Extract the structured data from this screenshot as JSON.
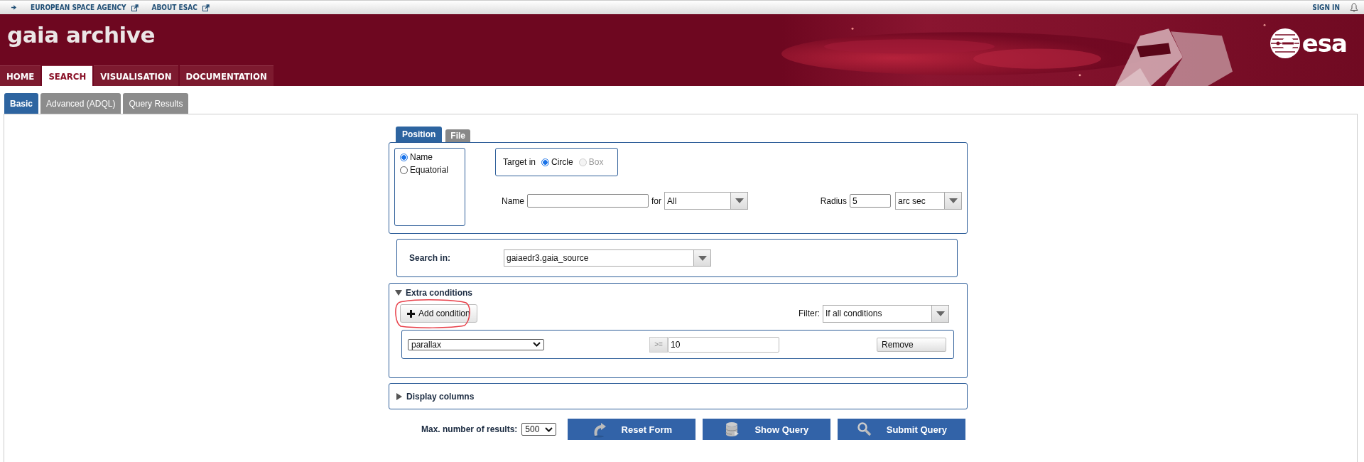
{
  "top_bar": {
    "links": [
      {
        "label": "EUROPEAN SPACE AGENCY"
      },
      {
        "label": "ABOUT ESAC"
      }
    ],
    "sign_in": "SIGN IN"
  },
  "header": {
    "title": "gaia archive",
    "logo_text": "esa"
  },
  "nav": [
    {
      "label": "HOME",
      "selected": false
    },
    {
      "label": "SEARCH",
      "selected": true
    },
    {
      "label": "VISUALISATION",
      "selected": false
    },
    {
      "label": "DOCUMENTATION",
      "selected": false
    }
  ],
  "subtabs": [
    {
      "label": "Basic",
      "selected": true
    },
    {
      "label": "Advanced (ADQL)",
      "selected": false
    },
    {
      "label": "Query Results",
      "selected": false
    }
  ],
  "position_tabs": [
    {
      "label": "Position",
      "selected": true
    },
    {
      "label": "File",
      "selected": false
    }
  ],
  "target_mode": [
    {
      "label": "Name",
      "selected": true
    },
    {
      "label": "Equatorial",
      "selected": false
    }
  ],
  "target_in": {
    "label": "Target in",
    "options": [
      {
        "label": "Circle",
        "selected": true,
        "disabled": false
      },
      {
        "label": "Box",
        "selected": false,
        "disabled": true
      }
    ]
  },
  "name_field": {
    "label": "Name"
  },
  "for_field": {
    "label": "for",
    "value": "All"
  },
  "radius": {
    "label": "Radius",
    "value": "5",
    "unit": "arc sec"
  },
  "search_in": {
    "label": "Search in:",
    "value": "gaiaedr3.gaia_source"
  },
  "extra_conditions": {
    "title": "Extra conditions",
    "expanded": true,
    "add_button": "Add condition",
    "filter_label": "Filter:",
    "filter_value": "If all conditions",
    "conditions": [
      {
        "column": "parallax",
        "operator": ">=",
        "value": "10",
        "remove": "Remove"
      }
    ]
  },
  "display_columns": {
    "title": "Display columns",
    "expanded": false
  },
  "max_results": {
    "label": "Max. number of results:",
    "value": "500"
  },
  "actions": [
    {
      "label": "Reset Form",
      "kind": "reset"
    },
    {
      "label": "Show Query",
      "kind": "show"
    },
    {
      "label": "Submit Query",
      "kind": "submit"
    }
  ]
}
